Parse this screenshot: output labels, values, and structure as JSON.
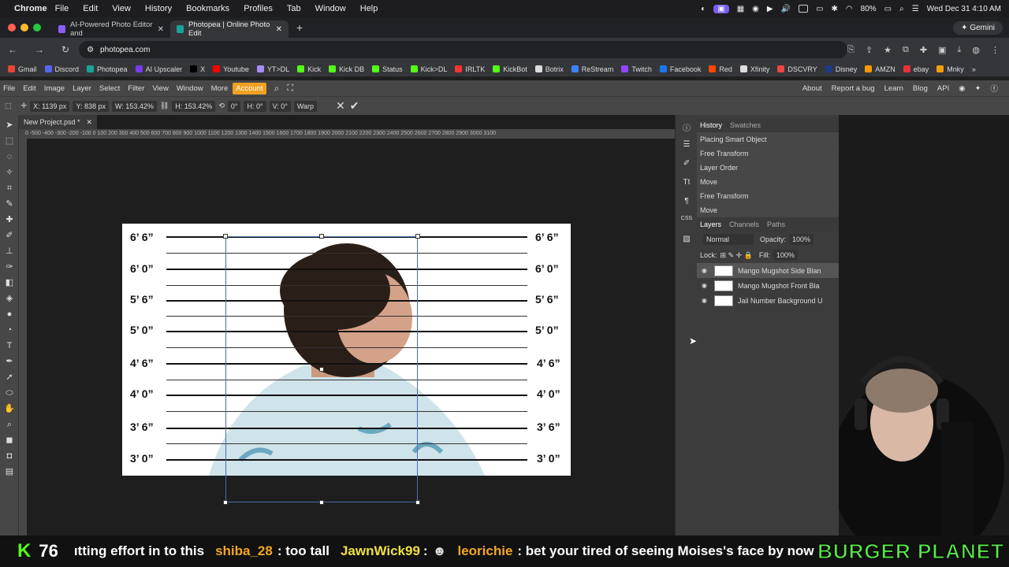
{
  "mac_menu": {
    "apple": "",
    "app": "Chrome",
    "items": [
      "File",
      "Edit",
      "View",
      "History",
      "Bookmarks",
      "Profiles",
      "Tab",
      "Window",
      "Help"
    ],
    "battery": "80%",
    "datetime": "Wed Dec 31  4:10 AM"
  },
  "tabs": [
    {
      "title": "AI-Powered Photo Editor and",
      "favicon_color": "#8b5cf6"
    },
    {
      "title": "Photopea | Online Photo Edit",
      "favicon_color": "#18a497"
    }
  ],
  "new_tab": "+",
  "gemini": "Gemini",
  "url": "photopea.com",
  "bookmarks": [
    {
      "label": "Gmail",
      "color": "#ea4335"
    },
    {
      "label": "Discord",
      "color": "#5865f2"
    },
    {
      "label": "Photopea",
      "color": "#18a497"
    },
    {
      "label": "AI Upscaler",
      "color": "#7c3aed"
    },
    {
      "label": "X",
      "color": "#000000"
    },
    {
      "label": "Youtube",
      "color": "#ff0000"
    },
    {
      "label": "YT>DL",
      "color": "#a78bfa"
    },
    {
      "label": "Kick",
      "color": "#53fc18"
    },
    {
      "label": "Kick DB",
      "color": "#53fc18"
    },
    {
      "label": "Status",
      "color": "#53fc18"
    },
    {
      "label": "Kick>DL",
      "color": "#53fc18"
    },
    {
      "label": "IRLTK",
      "color": "#ff3333"
    },
    {
      "label": "KickBot",
      "color": "#53fc18"
    },
    {
      "label": "Botrix",
      "color": "#dddddd"
    },
    {
      "label": "ReStream",
      "color": "#3b82f6"
    },
    {
      "label": "Twitch",
      "color": "#9146ff"
    },
    {
      "label": "Facebook",
      "color": "#1877f2"
    },
    {
      "label": "Red",
      "color": "#ff4500"
    },
    {
      "label": "Xfinity",
      "color": "#dddddd"
    },
    {
      "label": "DSCVRY",
      "color": "#ef4444"
    },
    {
      "label": "Disney",
      "color": "#1e3a8a"
    },
    {
      "label": "AMZN",
      "color": "#ff9900"
    },
    {
      "label": "ebay",
      "color": "#e53238"
    },
    {
      "label": "Mnky",
      "color": "#f59e0b"
    }
  ],
  "pp_menu": {
    "items": [
      "File",
      "Edit",
      "Image",
      "Layer",
      "Select",
      "Filter",
      "View",
      "Window",
      "More"
    ],
    "account": "Account",
    "links": [
      "About",
      "Report a bug",
      "Learn",
      "Blog",
      "API"
    ]
  },
  "options": {
    "x": "X: 1139 px",
    "y": "Y: 838 px",
    "w": "W: 153.42%",
    "h": "H: 153.42%",
    "angle": "0°",
    "hskew": "H: 0°",
    "vskew": "V: 0°",
    "warp": "Warp"
  },
  "doc": {
    "name": "New Project.psd *"
  },
  "ruler": "0  -500 -400 -300 -200 -100  0    100  200  300  400  500  600  700  800  900  1000 1100 1200 1300 1400 1500 1600 1700 1800 1900 2000 2100 2200 2300 2400 2500 2600 2700 2800 2900 3000 3100",
  "height_marks": [
    "6’ 6”",
    "6’ 0”",
    "5’ 6”",
    "5’ 0”",
    "4’ 6”",
    "4’ 0”",
    "3’ 6”",
    "3’ 0”"
  ],
  "history": {
    "tabs": [
      "History",
      "Swatches"
    ],
    "items": [
      "Placing Smart Object",
      "Free Transform",
      "Layer Order",
      "Move",
      "Free Transform",
      "Move"
    ]
  },
  "layers": {
    "tabs": [
      "Layers",
      "Channels",
      "Paths"
    ],
    "blend": "Normal",
    "opacity_label": "Opacity:",
    "opacity": "100%",
    "lock_label": "Lock:",
    "fill_label": "Fill:",
    "fill": "100%",
    "items": [
      "Mango Mugshot Side Blan",
      "Mango Mugshot Front Bla",
      "Jail Number Background U"
    ]
  },
  "ticker": {
    "count": "76",
    "text1": "ıtting effort in to this",
    "user1": "shiba_28",
    "msg1": ": too tall",
    "user2": "JawnWick99",
    "msg2": ":",
    "user3": "leorichie",
    "msg3": ": bet your tired of seeing Moises's face by now",
    "brand": "BURGER PLANET"
  }
}
